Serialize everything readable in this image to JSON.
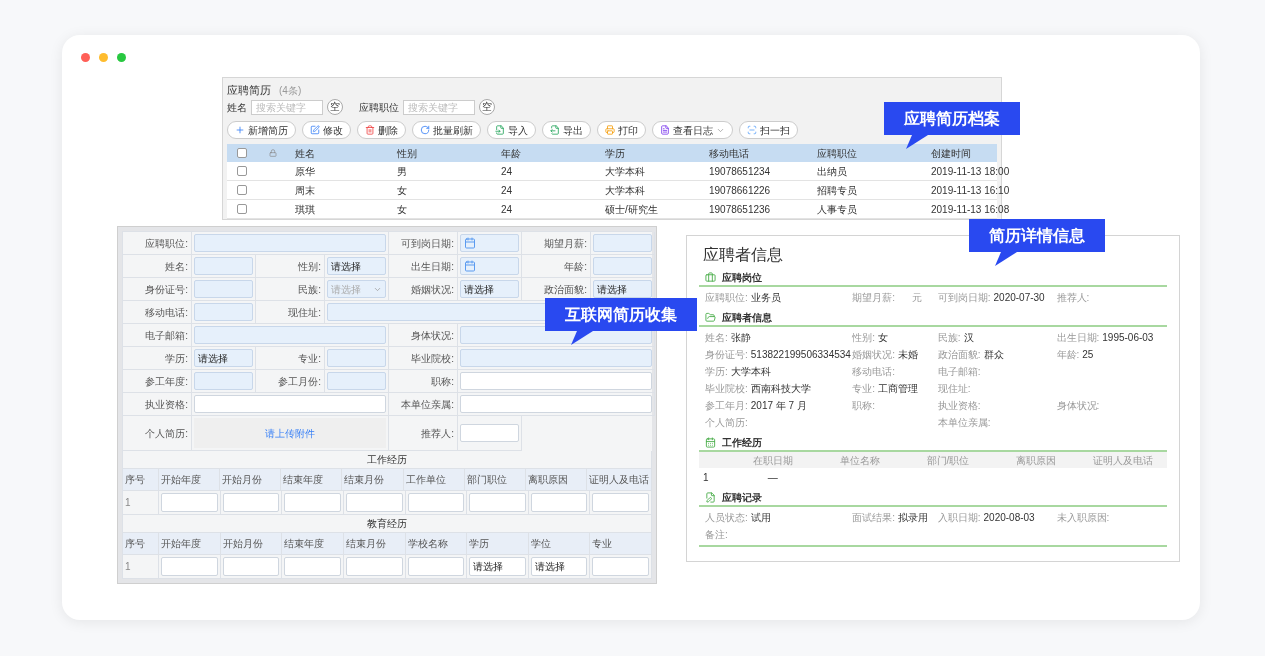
{
  "resume_list": {
    "title": "应聘简历",
    "count": "(4条)",
    "filters": [
      {
        "label": "姓名",
        "placeholder": "搜索关键字",
        "clear": "空"
      },
      {
        "label": "应聘职位",
        "placeholder": "搜索关键字",
        "clear": "空"
      }
    ],
    "toolbar": [
      {
        "label": "新增简历",
        "dropdown": false
      },
      {
        "label": "修改",
        "dropdown": false
      },
      {
        "label": "删除",
        "dropdown": false
      },
      {
        "label": "批量刷新",
        "dropdown": false
      },
      {
        "label": "导入",
        "dropdown": false
      },
      {
        "label": "导出",
        "dropdown": false
      },
      {
        "label": "打印",
        "dropdown": false
      },
      {
        "label": "查看日志",
        "dropdown": true
      },
      {
        "label": "扫一扫",
        "dropdown": false
      }
    ],
    "all_checked": false,
    "columns": [
      "姓名",
      "性别",
      "年龄",
      "学历",
      "移动电话",
      "应聘职位",
      "创建时间"
    ],
    "rows": [
      {
        "checked": false,
        "cells": [
          "原华",
          "男",
          "24",
          "大学本科",
          "19078651234",
          "出纳员",
          "2019-11-13 18:00"
        ]
      },
      {
        "checked": false,
        "cells": [
          "周末",
          "女",
          "24",
          "大学本科",
          "19078661226",
          "招聘专员",
          "2019-11-13 16:10"
        ]
      },
      {
        "checked": false,
        "cells": [
          "琪琪",
          "女",
          "24",
          "硕士/研究生",
          "19078651236",
          "人事专员",
          "2019-11-13 16:08"
        ]
      }
    ]
  },
  "application_form": {
    "rows": [
      {
        "fields": [
          {
            "label": "应聘职位:",
            "kind": "text",
            "required": true,
            "wide": true,
            "stretch": false
          },
          {
            "label": "可到岗日期:",
            "kind": "date",
            "required": true,
            "wide": false,
            "stretch": false
          },
          {
            "label": "期望月薪:",
            "kind": "text",
            "required": true,
            "wide": false,
            "stretch": false
          }
        ]
      },
      {
        "fields": [
          {
            "label": "姓名:",
            "kind": "text",
            "required": true,
            "wide": false,
            "stretch": false
          },
          {
            "label": "性别:",
            "kind": "select",
            "value": "请选择",
            "required": true,
            "wide": false,
            "stretch": false
          },
          {
            "label": "出生日期:",
            "kind": "date",
            "required": true,
            "wide": false,
            "stretch": false
          },
          {
            "label": "年龄:",
            "kind": "text",
            "required": true,
            "wide": false,
            "stretch": false
          }
        ]
      },
      {
        "fields": [
          {
            "label": "身份证号:",
            "kind": "text",
            "required": true,
            "wide": false,
            "stretch": false
          },
          {
            "label": "民族:",
            "kind": "dropdown",
            "placeholder": "请选择",
            "required": true,
            "wide": false,
            "stretch": false
          },
          {
            "label": "婚姻状况:",
            "kind": "select",
            "value": "请选择",
            "required": true,
            "wide": false,
            "stretch": false
          },
          {
            "label": "政治面貌:",
            "kind": "select",
            "value": "请选择",
            "required": true,
            "wide": false,
            "stretch": false
          }
        ]
      },
      {
        "fields": [
          {
            "label": "移动电话:",
            "kind": "text",
            "required": true,
            "wide": false,
            "stretch": false
          },
          {
            "label": "现住址:",
            "kind": "text",
            "required": true,
            "stretch": true
          }
        ]
      },
      {
        "fields": [
          {
            "label": "电子邮箱:",
            "kind": "text",
            "required": true,
            "wide": true,
            "stretch": false
          },
          {
            "label": "身体状况:",
            "kind": "text",
            "required": true,
            "wide": true,
            "stretch": false
          }
        ]
      },
      {
        "fields": [
          {
            "label": "学历:",
            "kind": "select",
            "value": "请选择",
            "required": true,
            "wide": false,
            "stretch": false
          },
          {
            "label": "专业:",
            "kind": "text",
            "required": true,
            "wide": false,
            "stretch": false
          },
          {
            "label": "毕业院校:",
            "kind": "text",
            "required": true,
            "wide": true,
            "stretch": false
          }
        ]
      },
      {
        "fields": [
          {
            "label": "参工年度:",
            "kind": "text",
            "required": true,
            "wide": false,
            "stretch": false
          },
          {
            "label": "参工月份:",
            "kind": "text",
            "required": true,
            "wide": false,
            "stretch": false
          },
          {
            "label": "职称:",
            "kind": "text",
            "required": false,
            "wide": true,
            "stretch": false
          }
        ]
      },
      {
        "fields": [
          {
            "label": "执业资格:",
            "kind": "text",
            "required": false,
            "wide": true,
            "stretch": false
          },
          {
            "label": "本单位亲属:",
            "kind": "text",
            "required": false,
            "wide": true,
            "stretch": false
          }
        ]
      },
      {
        "fields": [
          {
            "label": "个人简历:",
            "kind": "upload",
            "link": "请上传附件",
            "wide": true,
            "stretch": false
          },
          {
            "label": "推荐人:",
            "kind": "text",
            "required": false,
            "wide": false,
            "stretch": false
          }
        ]
      }
    ],
    "sections": [
      {
        "title": "工作经历",
        "columns": [
          "序号",
          "开始年度",
          "开始月份",
          "结束年度",
          "结束月份",
          "工作单位",
          "部门职位",
          "离职原因",
          "证明人及电话"
        ],
        "rows": [
          {
            "cells": [
              {
                "kind": "index",
                "text": "1"
              },
              {
                "kind": "input"
              },
              {
                "kind": "input"
              },
              {
                "kind": "input"
              },
              {
                "kind": "input"
              },
              {
                "kind": "input"
              },
              {
                "kind": "input"
              },
              {
                "kind": "input"
              },
              {
                "kind": "input"
              }
            ]
          }
        ]
      },
      {
        "title": "教育经历",
        "columns": [
          "序号",
          "开始年度",
          "开始月份",
          "结束年度",
          "结束月份",
          "学校名称",
          "学历",
          "学位",
          "专业"
        ],
        "rows": [
          {
            "cells": [
              {
                "kind": "index",
                "text": "1"
              },
              {
                "kind": "input"
              },
              {
                "kind": "input"
              },
              {
                "kind": "input"
              },
              {
                "kind": "input"
              },
              {
                "kind": "input"
              },
              {
                "kind": "select",
                "value": "请选择"
              },
              {
                "kind": "select",
                "value": "请选择"
              },
              {
                "kind": "input"
              }
            ]
          }
        ]
      }
    ]
  },
  "applicant_detail": {
    "title": "应聘者信息",
    "sections": [
      {
        "title": "应聘岗位",
        "kind": "fields",
        "fields": [
          {
            "label": "应聘职位:",
            "value": "业务员",
            "wide": false
          },
          {
            "label": "期望月薪:",
            "unit": "元",
            "wide": false
          },
          {
            "label": "可到岗日期:",
            "value": "2020-07-30",
            "wide": false
          },
          {
            "label": "推荐人:",
            "wide": false
          }
        ]
      },
      {
        "title": "应聘者信息",
        "kind": "fields",
        "fields": [
          {
            "label": "姓名:",
            "value": "张静",
            "wide": false
          },
          {
            "label": "性别:",
            "value": "女",
            "wide": false
          },
          {
            "label": "民族:",
            "value": "汉",
            "wide": false
          },
          {
            "label": "出生日期:",
            "value": "1995-06-03",
            "wide": false
          },
          {
            "label": "身份证号:",
            "value": "513822199506334534",
            "wide": false
          },
          {
            "label": "婚姻状况:",
            "value": "未婚",
            "wide": false
          },
          {
            "label": "政治面貌:",
            "value": "群众",
            "wide": false
          },
          {
            "label": "年龄:",
            "value": "25",
            "wide": false
          },
          {
            "label": "学历:",
            "value": "大学本科",
            "wide": false
          },
          {
            "label": "移动电话:",
            "wide": false
          },
          {
            "label": "电子邮箱:",
            "wide": true
          },
          {
            "label": "毕业院校:",
            "value": "西南科技大学",
            "wide": false
          },
          {
            "label": "专业:",
            "value": "工商管理",
            "wide": false
          },
          {
            "label": "现住址:",
            "wide": true
          },
          {
            "label": "参工年月:",
            "value": "2017 年 7 月",
            "wide": false
          },
          {
            "label": "职称:",
            "wide": false
          },
          {
            "label": "执业资格:",
            "wide": false
          },
          {
            "label": "身体状况:",
            "wide": false
          },
          {
            "label": "个人简历:",
            "wide": true
          },
          {
            "label": "本单位亲属:",
            "wide": true
          }
        ]
      },
      {
        "title": "工作经历",
        "kind": "table",
        "columns": [
          "在职日期",
          "单位名称",
          "部门/职位",
          "离职原因",
          "证明人及电话"
        ],
        "rows": [
          {
            "index": "1",
            "cells": [
              "—"
            ]
          }
        ]
      },
      {
        "title": "应聘记录",
        "kind": "fields",
        "fields": [
          {
            "label": "人员状态:",
            "value": "试用",
            "wide": false
          },
          {
            "label": "面试结果:",
            "value": "拟录用",
            "wide": false
          },
          {
            "label": "入职日期:",
            "value": "2020-08-03",
            "wide": false
          },
          {
            "label": "未入职原因:",
            "wide": false
          },
          {
            "label": "备注:",
            "wide": false
          }
        ]
      }
    ]
  },
  "callouts": [
    {
      "text": "应聘简历档案"
    },
    {
      "text": "简历详情信息"
    },
    {
      "text": "互联网简历收集"
    }
  ]
}
